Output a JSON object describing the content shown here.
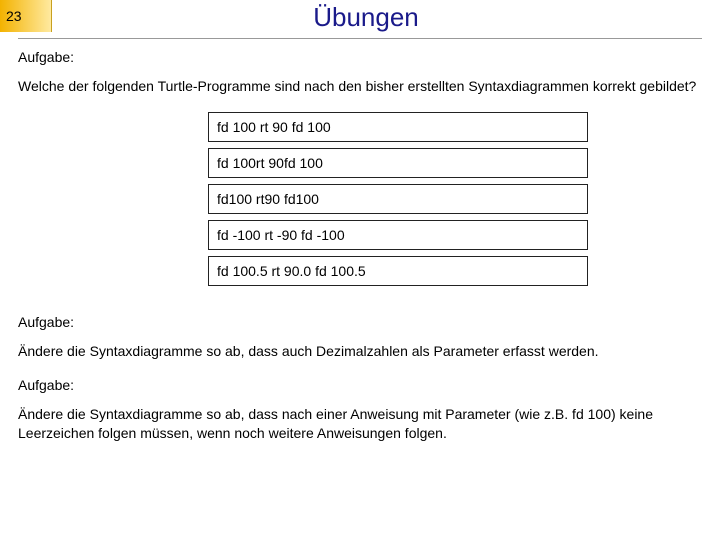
{
  "header": {
    "page_number": "23",
    "title": "Übungen"
  },
  "section1": {
    "label": "Aufgabe:",
    "text": "Welche der folgenden Turtle-Programme sind nach den bisher erstellten Syntaxdiagrammen korrekt gebildet?"
  },
  "codes": [
    "fd 100 rt 90 fd 100",
    "fd 100rt 90fd 100",
    "fd100 rt90 fd100",
    "fd -100 rt -90 fd -100",
    "fd 100.5 rt 90.0 fd 100.5"
  ],
  "section2": {
    "label": "Aufgabe:",
    "text": "Ändere die Syntaxdiagramme so ab, dass auch Dezimalzahlen als Parameter erfasst werden."
  },
  "section3": {
    "label": "Aufgabe:",
    "text": "Ändere die Syntaxdiagramme so ab, dass nach einer Anweisung mit Parameter (wie z.B. fd 100) keine Leerzeichen folgen müssen, wenn noch weitere Anweisungen folgen."
  }
}
